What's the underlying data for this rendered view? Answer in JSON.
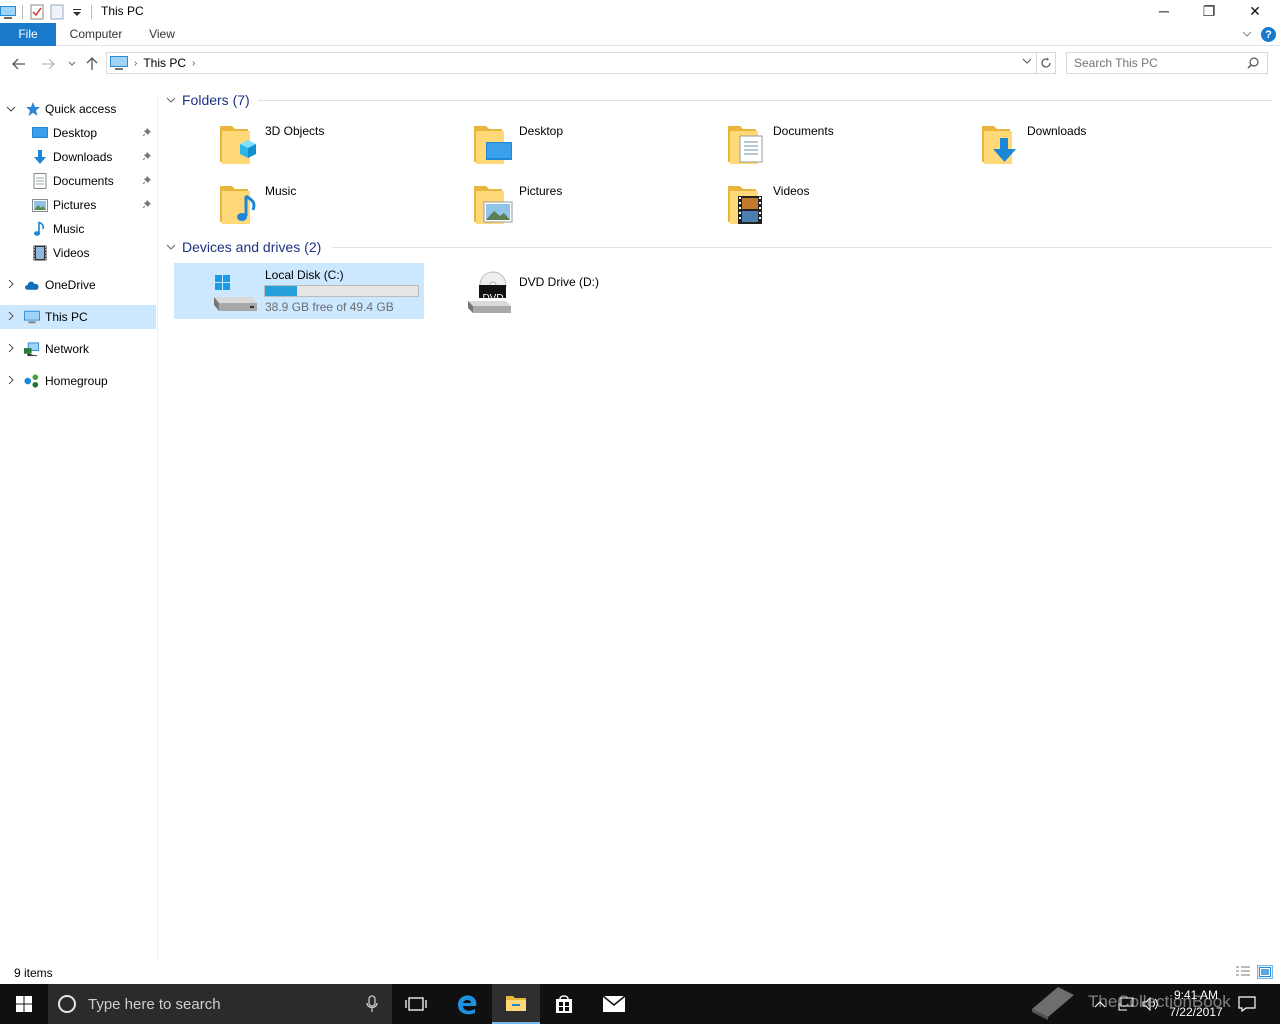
{
  "window": {
    "title": "This PC",
    "controls": {
      "minimize": "─",
      "restore": "❐",
      "close": "✕"
    }
  },
  "ribbon": {
    "tabs": [
      "File",
      "Computer",
      "View"
    ],
    "expand_icon": "chevron-down-icon",
    "help_label": "?"
  },
  "address": {
    "path": [
      "This PC"
    ],
    "search_placeholder": "Search This PC"
  },
  "sidebar": {
    "quick_access": "Quick access",
    "pinned": [
      {
        "label": "Desktop",
        "icon": "desktop-icon",
        "pinned": true
      },
      {
        "label": "Downloads",
        "icon": "downloads-icon",
        "pinned": true
      },
      {
        "label": "Documents",
        "icon": "documents-icon",
        "pinned": true
      },
      {
        "label": "Pictures",
        "icon": "pictures-icon",
        "pinned": true
      },
      {
        "label": "Music",
        "icon": "music-icon",
        "pinned": false
      },
      {
        "label": "Videos",
        "icon": "videos-icon",
        "pinned": false
      }
    ],
    "roots": [
      {
        "label": "OneDrive",
        "icon": "onedrive-icon"
      },
      {
        "label": "This PC",
        "icon": "this-pc-icon",
        "selected": true
      },
      {
        "label": "Network",
        "icon": "network-icon"
      },
      {
        "label": "Homegroup",
        "icon": "homegroup-icon"
      }
    ]
  },
  "content": {
    "folders_heading": "Folders (7)",
    "folders": [
      {
        "label": "3D Objects",
        "icon": "3d-objects-folder-icon"
      },
      {
        "label": "Desktop",
        "icon": "desktop-folder-icon"
      },
      {
        "label": "Documents",
        "icon": "documents-folder-icon"
      },
      {
        "label": "Downloads",
        "icon": "downloads-folder-icon"
      },
      {
        "label": "Music",
        "icon": "music-folder-icon"
      },
      {
        "label": "Pictures",
        "icon": "pictures-folder-icon"
      },
      {
        "label": "Videos",
        "icon": "videos-folder-icon"
      }
    ],
    "drives_heading": "Devices and drives (2)",
    "drives": [
      {
        "label": "Local Disk (C:)",
        "free": "38.9 GB free of 49.4 GB",
        "used_fraction": 0.21,
        "icon": "local-disk-icon",
        "selected": true
      },
      {
        "label": "DVD Drive (D:)",
        "icon": "dvd-drive-icon",
        "dvd_text": "DVD"
      }
    ]
  },
  "status": {
    "items": "9 items"
  },
  "taskbar": {
    "search_placeholder": "Type here to search",
    "apps": [
      "task-view-icon",
      "edge-icon",
      "file-explorer-icon",
      "store-icon",
      "mail-icon"
    ],
    "time": "9:41 AM",
    "date": "7/22/2017",
    "watermark": "TheCollectionBook"
  },
  "colors": {
    "accent": "#1979ca",
    "selected": "#cce8ff",
    "heading": "#1e3287",
    "drive_fill": "#26a0da"
  }
}
